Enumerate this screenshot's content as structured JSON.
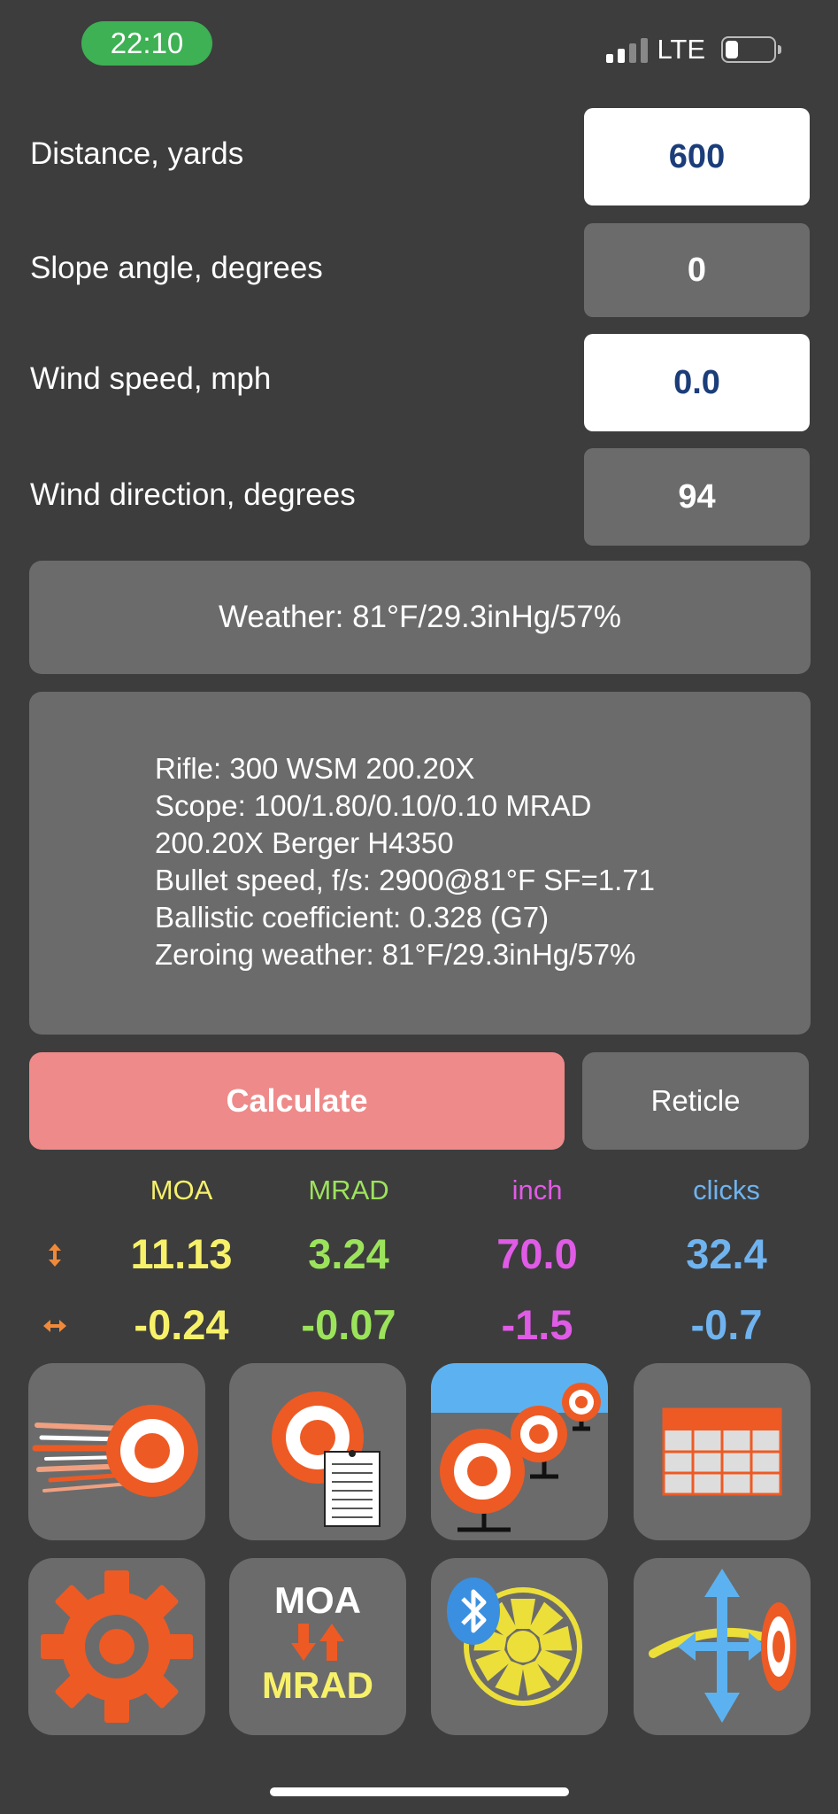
{
  "status_bar": {
    "time": "22:10",
    "network": "LTE"
  },
  "inputs": [
    {
      "label": "Distance, yards",
      "value": "600"
    },
    {
      "label": "Slope angle, degrees",
      "value": "0"
    },
    {
      "label": "Wind speed, mph",
      "value": "0.0"
    },
    {
      "label": "Wind direction, degrees",
      "value": "94"
    }
  ],
  "weather": "Weather: 81°F/29.3inHg/57%",
  "info_lines": [
    "Rifle: 300 WSM 200.20X",
    "Scope: 100/1.80/0.10/0.10 MRAD",
    "200.20X Berger H4350",
    "Bullet speed, f/s: 2900@81°F SF=1.71",
    "Ballistic coefficient: 0.328 (G7)",
    "Zeroing weather: 81°F/29.3inHg/57%"
  ],
  "buttons": {
    "calculate": "Calculate",
    "reticle": "Reticle"
  },
  "results": {
    "headers": [
      "MOA",
      "MRAD",
      "inch",
      "clicks"
    ],
    "vertical": [
      "11.13",
      "3.24",
      "70.0",
      "32.4"
    ],
    "horizontal": [
      "-0.24",
      "-0.07",
      "-1.5",
      "-0.7"
    ]
  },
  "tile_labels": {
    "moa": "MOA",
    "mrad": "MRAD"
  },
  "colors": {
    "moa": "#f7f16a",
    "mrad": "#9ce35c",
    "inch": "#e05be6",
    "clicks": "#6fb3ef",
    "accent": "#ee5a24"
  },
  "tiles": [
    "moving-target-icon",
    "target-report-icon",
    "multiple-targets-icon",
    "range-table-icon",
    "settings-gear-icon",
    "moa-mrad-converter-icon",
    "bluetooth-wind-meter-icon",
    "elevation-windage-icon"
  ]
}
